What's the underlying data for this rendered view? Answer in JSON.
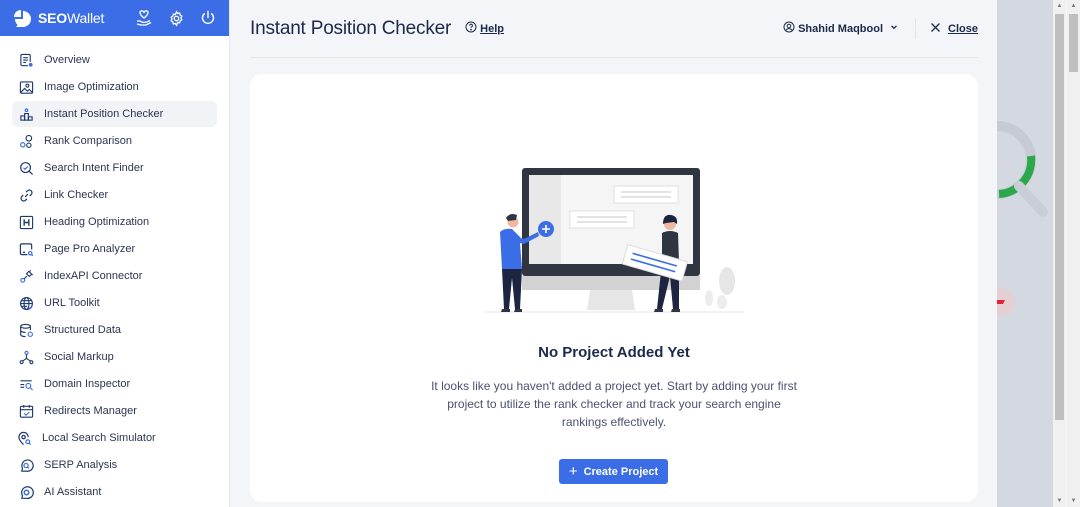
{
  "app": {
    "brand_bold": "SEO",
    "brand_rest": "Wallet",
    "header_icons": [
      "heart-hand-icon",
      "gear-icon",
      "power-icon"
    ]
  },
  "sidebar": {
    "active_index": 2,
    "items": [
      {
        "label": "Overview",
        "icon": "overview-icon"
      },
      {
        "label": "Image Optimization",
        "icon": "image-icon"
      },
      {
        "label": "Instant Position Checker",
        "icon": "podium-icon"
      },
      {
        "label": "Rank Comparison",
        "icon": "rank-compare-icon"
      },
      {
        "label": "Search Intent Finder",
        "icon": "search-intent-icon"
      },
      {
        "label": "Link Checker",
        "icon": "link-icon"
      },
      {
        "label": "Heading Optimization",
        "icon": "heading-icon"
      },
      {
        "label": "Page Pro Analyzer",
        "icon": "page-analyzer-icon"
      },
      {
        "label": "IndexAPI Connector",
        "icon": "plug-icon"
      },
      {
        "label": "URL Toolkit",
        "icon": "globe-icon"
      },
      {
        "label": "Structured Data",
        "icon": "database-icon"
      },
      {
        "label": "Social Markup",
        "icon": "share-nodes-icon"
      },
      {
        "label": "Domain Inspector",
        "icon": "domain-search-icon"
      },
      {
        "label": "Redirects Manager",
        "icon": "calendar-check-icon"
      },
      {
        "label": "Local Search Simulator",
        "icon": "location-search-icon"
      },
      {
        "label": "SERP Analysis",
        "icon": "serp-chat-icon"
      },
      {
        "label": "AI Assistant",
        "icon": "ai-chat-icon"
      }
    ]
  },
  "header": {
    "title": "Instant Position Checker",
    "help_label": "Help",
    "user_name": "Shahid Maqbool",
    "close_label": "Close"
  },
  "empty_state": {
    "title": "No Project Added Yet",
    "description": "It looks like you haven't added a project yet. Start by adding your first project to utilize the rank checker and track your search engine rankings effectively.",
    "button_label": "Create Project",
    "illustration": "people-adding-project-to-monitor"
  },
  "colors": {
    "brand": "#3b6ee6",
    "text_dark": "#1b2a4a",
    "background": "#f4f5f8"
  }
}
